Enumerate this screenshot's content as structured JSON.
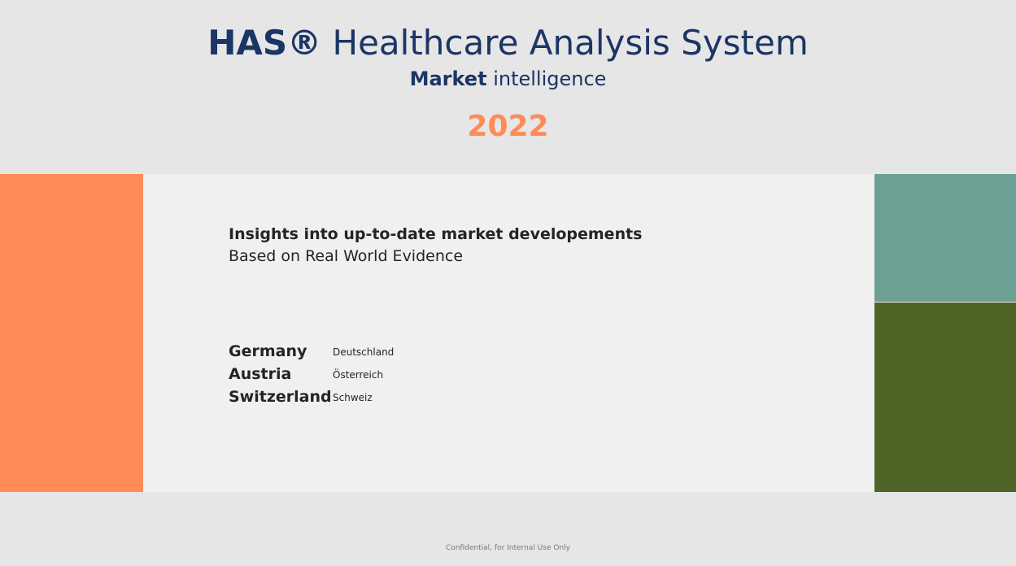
{
  "header": {
    "brand": "HAS®",
    "system": "Healthcare Analysis System",
    "subtitle_bold": "Market",
    "subtitle_rest": "intelligence",
    "year": "2022"
  },
  "content": {
    "insight_title": "Insights into up-to-date market developements",
    "insight_subtitle": "Based on Real World Evidence",
    "countries": [
      {
        "en": "Germany",
        "local": "Deutschland"
      },
      {
        "en": "Austria",
        "local": "Österreich"
      },
      {
        "en": "Switzerland",
        "local": "Schweiz"
      }
    ]
  },
  "footer": {
    "text": "Confidential, for Internal Use Only"
  },
  "colors": {
    "accent_orange": "#ff8b58",
    "navy": "#1b3565",
    "teal": "#6da095",
    "olive": "#4f6427"
  }
}
